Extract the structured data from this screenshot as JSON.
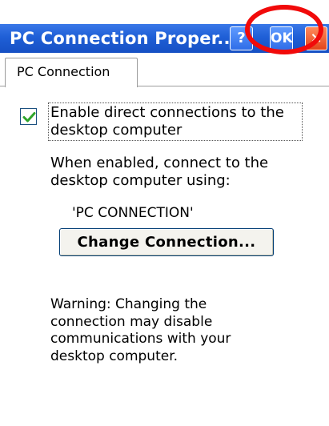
{
  "window": {
    "title": "PC Connection Proper...",
    "help_label": "?",
    "ok_label": "OK",
    "close_label": "×"
  },
  "tabs": [
    {
      "label": "PC Connection",
      "selected": true
    }
  ],
  "checkbox": {
    "checked": true,
    "label": "Enable direct connections to the desktop computer"
  },
  "description": {
    "line1": "When enabled, connect to the",
    "line2": "desktop computer using:"
  },
  "connection_name": "'PC CONNECTION'",
  "change_button_label": "Change Connection...",
  "warning": {
    "line1": "Warning: Changing the",
    "line2": "connection may disable",
    "line3": "communications with your",
    "line4": "desktop computer."
  },
  "colors": {
    "title_bar": "#1f5fd6",
    "close_button": "#e2451b",
    "annotation_circle": "#f10a0a",
    "checkmark": "#2fa52b"
  },
  "icons": {
    "help": "help-icon",
    "ok": "ok-button",
    "close": "close-icon",
    "check": "checkmark-icon"
  }
}
